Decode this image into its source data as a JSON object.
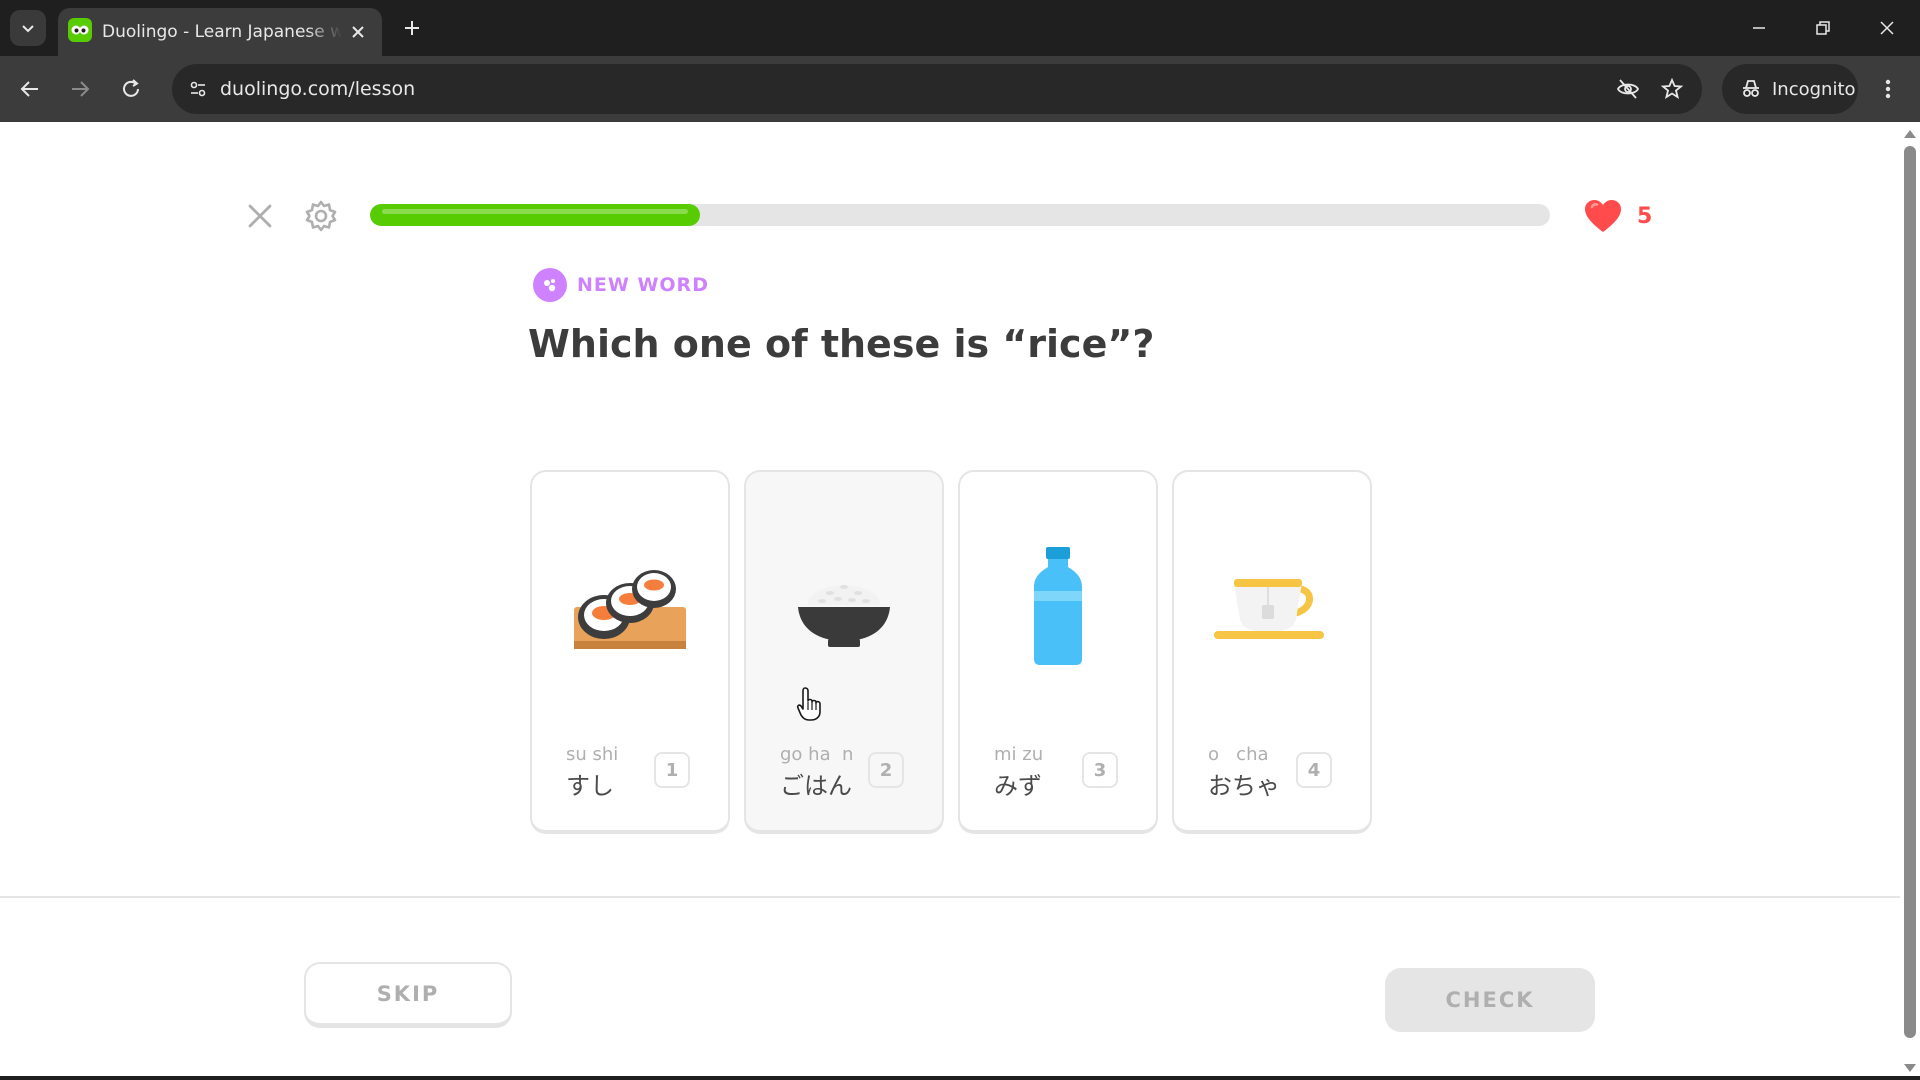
{
  "browser": {
    "tab": {
      "title": "Duolingo - Learn Japanese with",
      "favicon": "duolingo-owl-icon"
    },
    "address_bar": {
      "url": "duolingo.com/lesson"
    },
    "incognito_label": "Incognito",
    "colors": {
      "chrome_dark": "#1f1f1f",
      "toolbar": "#3c3c3c"
    }
  },
  "lesson": {
    "progress": 0.28,
    "hearts": "5",
    "colors": {
      "green": "#58cc02",
      "red": "#ff4b4b",
      "purple": "#ce82ff"
    }
  },
  "challenge": {
    "badge": "NEW WORD",
    "question": "Which one of these is “rice”?",
    "choices": [
      {
        "romaji": "su shi",
        "kana": "すし",
        "key": "1",
        "icon": "sushi-icon"
      },
      {
        "romaji": "go ha  n",
        "kana": "ごはん",
        "key": "2",
        "icon": "rice-bowl-icon"
      },
      {
        "romaji": "mi zu",
        "kana": "みず",
        "key": "3",
        "icon": "water-bottle-icon"
      },
      {
        "romaji": "o   cha",
        "kana": "おちゃ",
        "key": "4",
        "icon": "tea-cup-icon"
      }
    ]
  },
  "footer": {
    "skip_label": "SKIP",
    "check_label": "CHECK"
  }
}
